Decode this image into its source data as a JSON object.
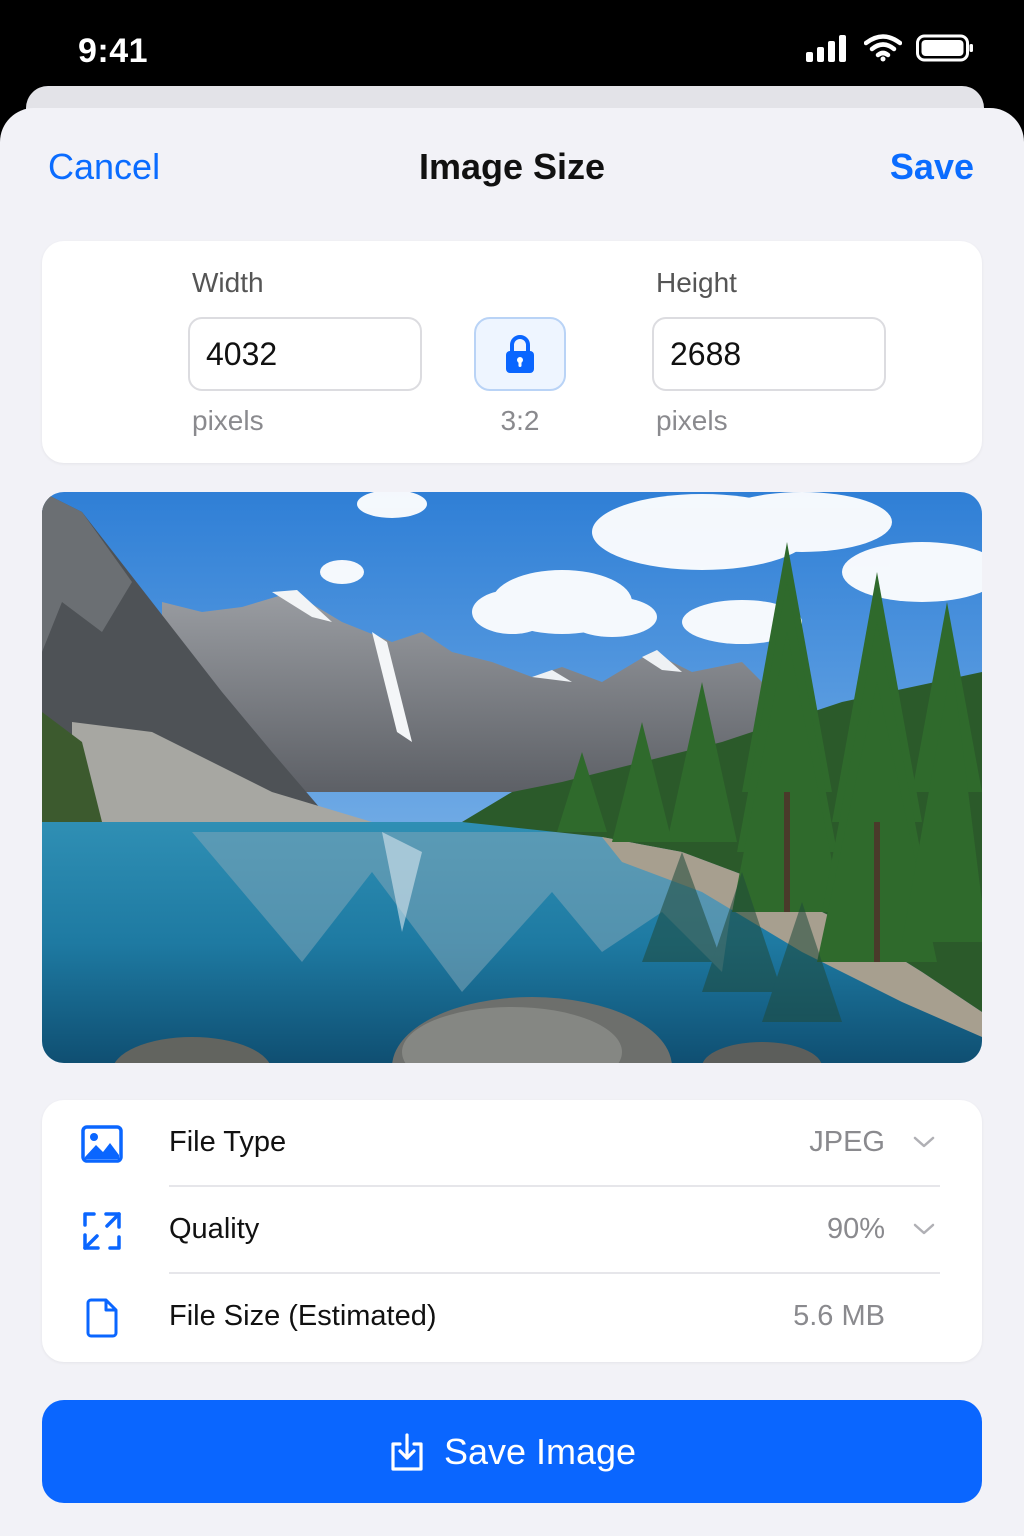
{
  "status_bar": {
    "time": "9:41",
    "icons": [
      "cellular-signal-icon",
      "wifi-icon",
      "battery-icon"
    ]
  },
  "nav": {
    "cancel_label": "Cancel",
    "title": "Image Size",
    "save_label": "Save"
  },
  "dimensions": {
    "width_label": "Width",
    "width_value": "4032",
    "width_unit": "pixels",
    "height_label": "Height",
    "height_value": "2688",
    "height_unit": "pixels",
    "aspect_ratio": "3:2",
    "aspect_lock_icon": "lock-icon",
    "aspect_locked": true
  },
  "preview": {
    "icon": "landscape-photo"
  },
  "settings": {
    "rows": [
      {
        "icon": "image-icon",
        "label": "File Type",
        "value": "JPEG",
        "has_chevron": true
      },
      {
        "icon": "resize-arrows-icon",
        "label": "Quality",
        "value": "90%",
        "has_chevron": true
      },
      {
        "icon": "document-icon",
        "label": "File Size (Estimated)",
        "value": "5.6 MB",
        "has_chevron": false
      }
    ]
  },
  "primary_action": {
    "label": "Save Image",
    "icon": "download-icon"
  },
  "colors": {
    "accent": "#0a66ff",
    "link": "#0a6cff",
    "background": "#f2f2f7",
    "card": "#ffffff",
    "secondary_text": "#8a8a8e"
  }
}
